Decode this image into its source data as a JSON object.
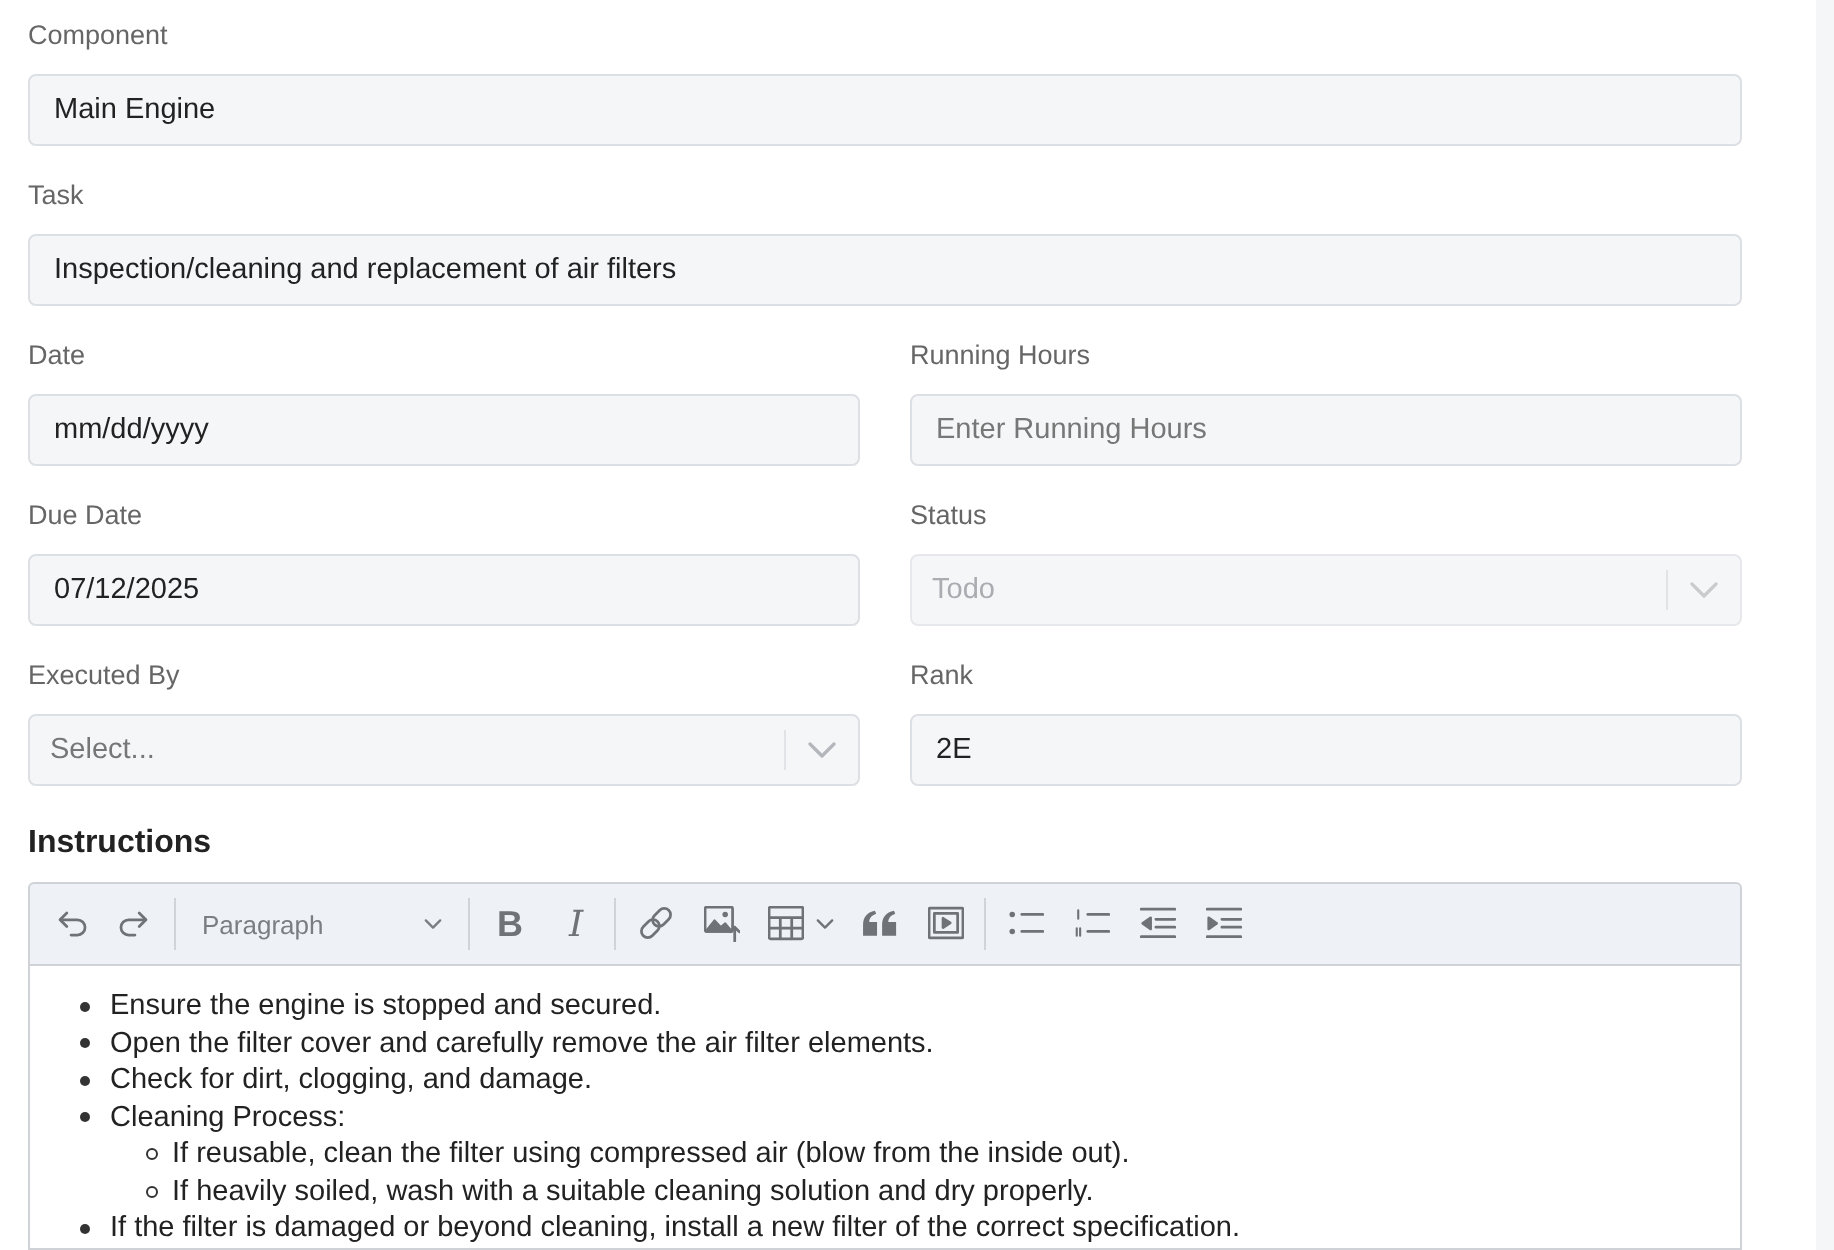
{
  "form": {
    "rows": [
      [
        {
          "label": "Component",
          "kind": "text",
          "value": "Main Engine"
        }
      ],
      [
        {
          "label": "Task",
          "kind": "text",
          "value": "Inspection/cleaning and replacement of air filters"
        }
      ],
      [
        {
          "label": "Date",
          "kind": "date",
          "placeholder": "mm/dd/yyyy"
        },
        {
          "label": "Running Hours",
          "kind": "text",
          "placeholder": "Enter Running Hours"
        }
      ],
      [
        {
          "label": "Due Date",
          "kind": "date",
          "value": "07/12/2025"
        },
        {
          "label": "Status",
          "kind": "select",
          "value": "Todo",
          "disabled": true
        }
      ],
      [
        {
          "label": "Executed By",
          "kind": "select",
          "placeholder": "Select...",
          "disabled": false
        },
        {
          "label": "Rank",
          "kind": "text",
          "value": "2E"
        }
      ]
    ]
  },
  "instructions": {
    "title": "Instructions",
    "toolbar": [
      {
        "kind": "undo"
      },
      {
        "kind": "redo"
      },
      {
        "kind": "separator"
      },
      {
        "kind": "heading",
        "label": "Paragraph"
      },
      {
        "kind": "separator"
      },
      {
        "kind": "bold",
        "label": "B"
      },
      {
        "kind": "italic",
        "label": "I"
      },
      {
        "kind": "separator"
      },
      {
        "kind": "link"
      },
      {
        "kind": "image"
      },
      {
        "kind": "table"
      },
      {
        "kind": "quote"
      },
      {
        "kind": "media"
      },
      {
        "kind": "separator"
      },
      {
        "kind": "bulleted-list"
      },
      {
        "kind": "numbered-list"
      },
      {
        "kind": "outdent"
      },
      {
        "kind": "indent"
      }
    ],
    "content": [
      {
        "text": "Ensure the engine is stopped and secured."
      },
      {
        "text": "Open the filter cover and carefully remove the air filter elements."
      },
      {
        "text": "Check for dirt, clogging, and damage."
      },
      {
        "text": "Cleaning Process:",
        "children": [
          {
            "text": "If reusable, clean the filter using compressed air (blow from the inside out)."
          },
          {
            "text": "If heavily soiled, wash with a suitable cleaning solution and dry properly."
          }
        ]
      },
      {
        "text": "If the filter is damaged or beyond cleaning, install a new filter of the correct specification."
      }
    ]
  }
}
